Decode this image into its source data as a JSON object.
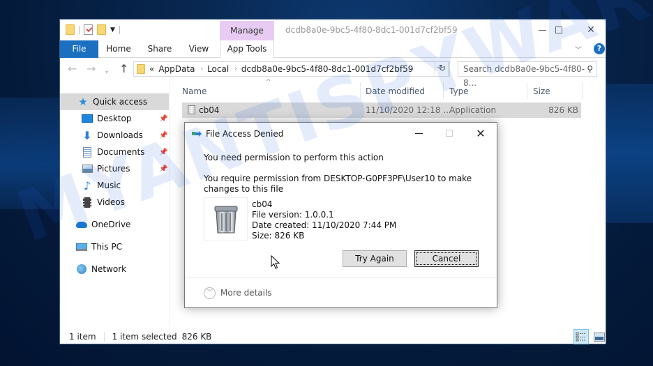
{
  "window": {
    "title": "dcdb8a0e-9bc5-4f80-8dc1-001d7cf2bf59",
    "contextual_tab_group": "Manage"
  },
  "ribbon": {
    "tabs": [
      {
        "label": "File",
        "active": true
      },
      {
        "label": "Home"
      },
      {
        "label": "Share"
      },
      {
        "label": "View"
      },
      {
        "label": "App Tools"
      }
    ],
    "help_icon": "?"
  },
  "address_bar": {
    "overflow": "«",
    "crumbs": [
      "AppData",
      "Local",
      "dcdb8a0e-9bc5-4f80-8dc1-001d7cf2bf59"
    ],
    "separator": "›"
  },
  "search": {
    "placeholder": "Search dcdb8a0e-9bc5-4f80-8..."
  },
  "sidebar": {
    "items": [
      {
        "label": "Quick access",
        "icon": "star-icon",
        "active": true
      },
      {
        "label": "Desktop",
        "icon": "desktop-icon",
        "pinned": true
      },
      {
        "label": "Downloads",
        "icon": "download-icon",
        "pinned": true
      },
      {
        "label": "Documents",
        "icon": "documents-icon",
        "pinned": true
      },
      {
        "label": "Pictures",
        "icon": "pictures-icon",
        "pinned": true
      },
      {
        "label": "Music",
        "icon": "music-icon"
      },
      {
        "label": "Videos",
        "icon": "videos-icon"
      },
      {
        "label": "OneDrive",
        "icon": "cloud-icon"
      },
      {
        "label": "This PC",
        "icon": "computer-icon"
      },
      {
        "label": "Network",
        "icon": "network-icon"
      }
    ]
  },
  "file_list": {
    "columns": [
      "Name",
      "Date modified",
      "Type",
      "Size"
    ],
    "rows": [
      {
        "name": "cb04",
        "date_modified": "11/10/2020 12:18 ...",
        "type": "Application",
        "size": "826 KB",
        "selected": true
      }
    ]
  },
  "status_bar": {
    "count": "1 item",
    "selection": "1 item selected",
    "selection_size": "826 KB"
  },
  "dialog": {
    "title": "File Access Denied",
    "message1": "You need permission to perform this action",
    "message2": "You require permission from DESKTOP-G0PF3PF\\User10 to make changes to this file",
    "file_name": "cb04",
    "file_version": "File version: 1.0.0.1",
    "date_created": "Date created: 11/10/2020 7:44 PM",
    "size": "Size: 826 KB",
    "try_again_label": "Try Again",
    "cancel_label": "Cancel",
    "more_details_label": "More details"
  },
  "watermark": "MYANTISPYWARE.COM"
}
